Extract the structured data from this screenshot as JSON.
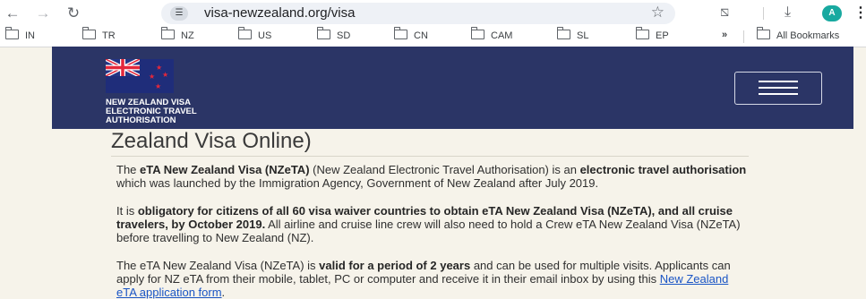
{
  "browser": {
    "url": "visa-newzealand.org/visa",
    "avatar_letter": "A",
    "icons": [
      "back-arrow-icon",
      "forward-arrow-icon",
      "reload-icon",
      "site-info-icon",
      "star-icon",
      "extensions-icon",
      "download-icon",
      "more-menu-icon",
      "folder-icon"
    ],
    "bookmarks": [
      "IN",
      "TR",
      "NZ",
      "US",
      "SD",
      "CN",
      "CAM",
      "SL",
      "EP"
    ],
    "overflow_label": "»",
    "all_bookmarks": "All Bookmarks"
  },
  "header": {
    "site_name": "NEW ZEALAND VISA\nELECTRONIC TRAVEL\nAUTHORISATION",
    "color": "#2b3566"
  },
  "article": {
    "title": "Zealand Visa Online)",
    "p1": {
      "a": "The ",
      "b1": "eTA New Zealand Visa (NZeTA)",
      "c": " (New Zealand Electronic Travel Authorisation) is an ",
      "b2": "electronic travel authorisation",
      "d": " which was launched by the Immigration Agency, Government of New Zealand after July 2019."
    },
    "p2": {
      "a": "It is ",
      "b1": "obligatory for citizens of all 60 visa waiver countries to obtain eTA New Zealand Visa (NZeTA), and all cruise travelers, by October 2019.",
      "c": " All airline and cruise line crew will also need to hold a Crew eTA New Zealand Visa (NZeTA) before travelling to New Zealand (NZ)."
    },
    "p3": {
      "a": "The eTA New Zealand Visa (NZeTA) is ",
      "b1": "valid for a period of 2 years",
      "c": " and can be used for multiple visits. Applicants can apply for NZ eTA from their mobile, tablet, PC or computer and receive it in their email inbox by using this ",
      "link": "New Zealand eTA application form",
      "d": "."
    },
    "link_color": "#1a55c5"
  }
}
